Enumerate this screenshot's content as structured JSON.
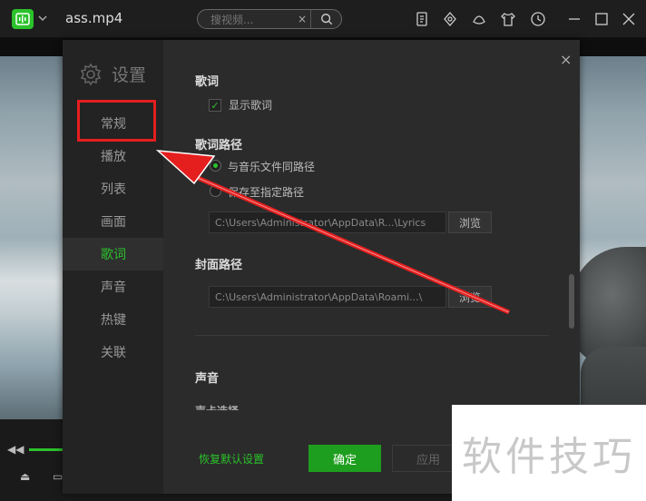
{
  "window": {
    "title": "ass.mp4",
    "search_placeholder": "搜视频...",
    "search_clear": "×"
  },
  "settings": {
    "title": "设置",
    "close": "×",
    "nav": [
      {
        "label": "常规"
      },
      {
        "label": "播放"
      },
      {
        "label": "列表"
      },
      {
        "label": "画面"
      },
      {
        "label": "歌词"
      },
      {
        "label": "声音"
      },
      {
        "label": "热键"
      },
      {
        "label": "关联"
      }
    ],
    "active_nav": "歌词",
    "lyrics": {
      "section_title": "歌词",
      "show_lyrics_label": "显示歌词",
      "show_lyrics_checked": true,
      "path_title": "歌词路径",
      "radio_same_label": "与音乐文件同路径",
      "radio_custom_label": "保存至指定路径",
      "path_value": "C:\\Users\\Administrator\\AppData\\R...\\Lyrics",
      "browse_label": "浏览"
    },
    "cover": {
      "section_title": "封面路径",
      "path_value": "C:\\Users\\Administrator\\AppData\\Roami...\\",
      "browse_label": "浏览"
    },
    "sound": {
      "section_title": "声音",
      "partial_label": "声卡选择"
    },
    "footer": {
      "reset_label": "恢复默认设置",
      "ok_label": "确定",
      "apply_label": "应用"
    }
  },
  "watermark": {
    "text": "软件技巧"
  },
  "colors": {
    "accent": "#2bc22b",
    "annotation": "#e51e1e"
  }
}
